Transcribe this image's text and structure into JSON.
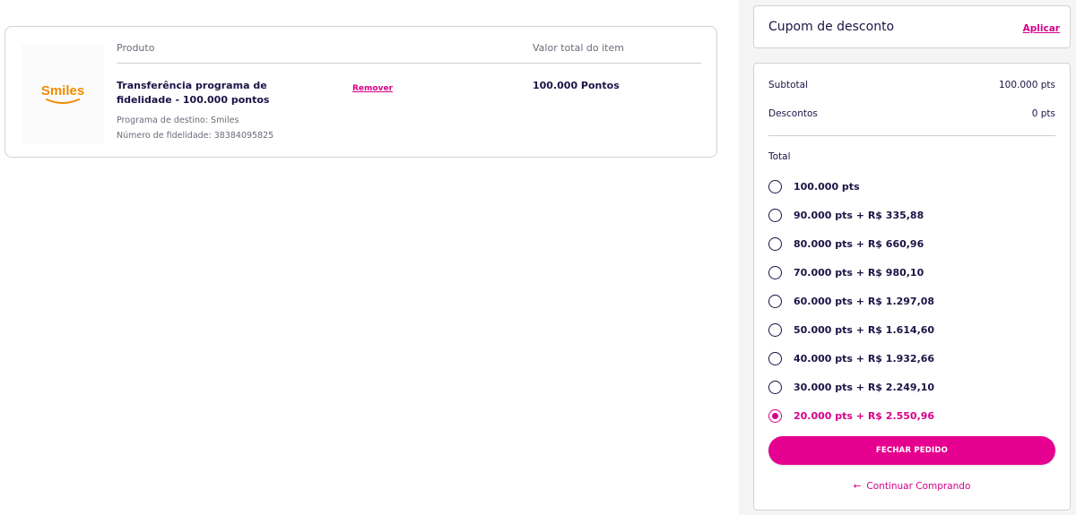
{
  "cart": {
    "header_product": "Produto",
    "header_value": "Valor total do item",
    "item": {
      "logo_text": "Smiles",
      "logo_color": "#f08c00",
      "name": "Transferência programa de fidelidade - 100.000 pontos",
      "remove_label": "Remover",
      "total": "100.000 Pontos",
      "destination": "Programa de destino: Smiles",
      "loyalty_number": "Número de fidelidade: 38384095825"
    }
  },
  "coupon": {
    "title": "Cupom de desconto",
    "apply_label": "Aplicar"
  },
  "summary": {
    "subtotal_label": "Subtotal",
    "subtotal_value": "100.000 pts",
    "discount_label": "Descontos",
    "discount_value": "0 pts",
    "total_label": "Total",
    "options": [
      {
        "label": "100.000 pts",
        "selected": false
      },
      {
        "label": "90.000 pts + R$ 335,88",
        "selected": false
      },
      {
        "label": "80.000 pts + R$ 660,96",
        "selected": false
      },
      {
        "label": "70.000 pts + R$ 980,10",
        "selected": false
      },
      {
        "label": "60.000 pts + R$ 1.297,08",
        "selected": false
      },
      {
        "label": "50.000 pts + R$ 1.614,60",
        "selected": false
      },
      {
        "label": "40.000 pts + R$ 1.932,66",
        "selected": false
      },
      {
        "label": "30.000 pts + R$ 2.249,10",
        "selected": false
      },
      {
        "label": "20.000 pts + R$ 2.550,96",
        "selected": true
      }
    ],
    "checkout_label": "FECHAR PEDIDO",
    "continue_label": "Continuar Comprando",
    "continue_icon": "arrow-left-icon"
  },
  "colors": {
    "accent": "#e6008f",
    "text": "#1a1446"
  }
}
